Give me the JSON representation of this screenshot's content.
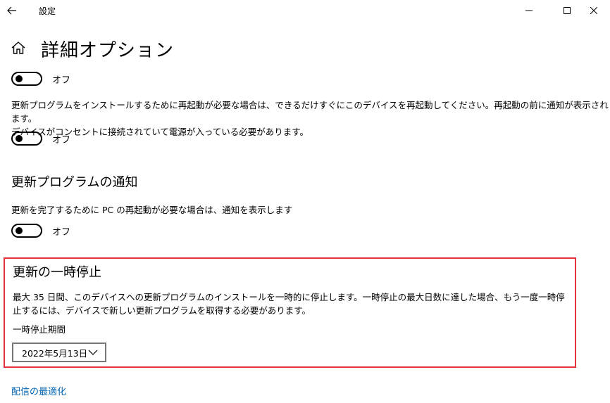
{
  "window": {
    "title": "設定"
  },
  "page": {
    "title": "詳細オプション"
  },
  "toggles": {
    "first": {
      "state_label": "オフ",
      "on": false
    },
    "restart": {
      "state_label": "オフ",
      "on": false
    },
    "notify": {
      "state_label": "オフ",
      "on": false
    }
  },
  "restart_section": {
    "description_line1": "更新プログラムをインストールするために再起動が必要な場合は、できるだけすぐにこのデバイスを再起動してください。再起動の前に通知が表示されます。",
    "description_line2": "デバイスがコンセントに接続されていて電源が入っている必要があります。"
  },
  "notify_section": {
    "heading": "更新プログラムの通知",
    "description": "更新を完了するために PC の再起動が必要な場合は、通知を表示します"
  },
  "pause_section": {
    "heading": "更新の一時停止",
    "description_line1": "最大 35 日間、このデバイスへの更新プログラムのインストールを一時的に停止します。一時停止の最大日数に達した場合、もう一度一時停止するには、デバイスで新しい更新プログラムを取得する必要があります。",
    "period_label": "一時停止期間",
    "selected_date": "2022年5月13日",
    "highlight_color": "#e3343d"
  },
  "footer": {
    "link_label": "配信の最適化",
    "link_color": "#0063b1"
  }
}
